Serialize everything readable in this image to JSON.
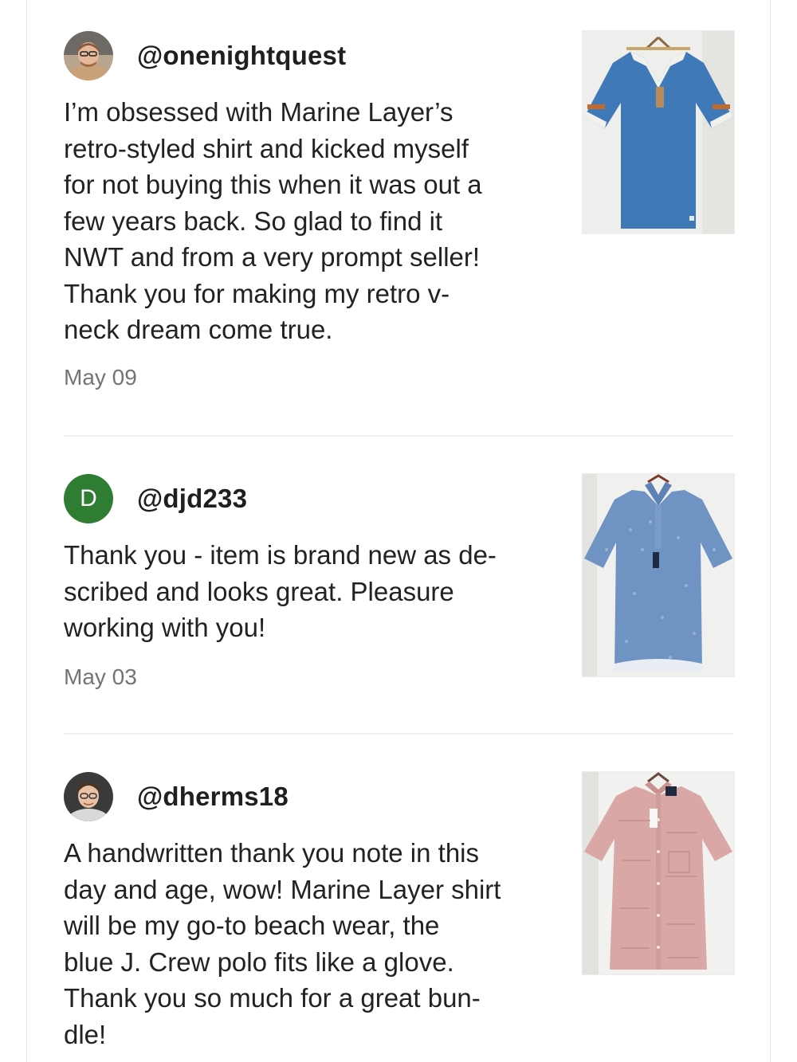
{
  "reviews": [
    {
      "username": "@onenightquest",
      "text": "I’m obsessed with Marine Layer’s retro-styled shirt and kicked myself for not buying this when it was out a few years back. So glad to find it NWT and from a very prompt seller! Thank you for making my retro v-neck dream come true.",
      "text_lines": [
        "I’m obsessed with Marine Layer’s",
        "retro-styled shirt and kicked myself",
        "for not buying this when it was out a",
        "few years back. So glad to find it",
        "NWT and from a very prompt seller!",
        "Thank you for making my retro v-",
        "neck dream come true."
      ],
      "date": "May 09",
      "avatar": "photo",
      "item_image": "blue v-neck retro tee on hanger"
    },
    {
      "username": "@djd233",
      "avatar_letter": "D",
      "avatar_color": "#2f7d32",
      "text_lines": [
        "Thank you - item is brand new as de-",
        "scribed and looks great. Pleasure",
        "working with you!"
      ],
      "date": "May 03",
      "avatar": "letter",
      "item_image": "blue patterned polo shirt on hanger"
    },
    {
      "username": "@dherms18",
      "text_lines": [
        "A handwritten thank you note in this",
        "day and age, wow! Marine Layer shirt",
        "will be my go-to beach wear, the",
        "blue J. Crew polo fits like a glove.",
        "Thank you so much for a great bun-",
        "dle!"
      ],
      "avatar": "photo",
      "item_image": "pink textured button-up shirt on hanger"
    }
  ],
  "colors": {
    "divider": "#efefef",
    "date_text": "#747474",
    "body_text": "#222222",
    "letter_avatar": "#2f7d32"
  }
}
